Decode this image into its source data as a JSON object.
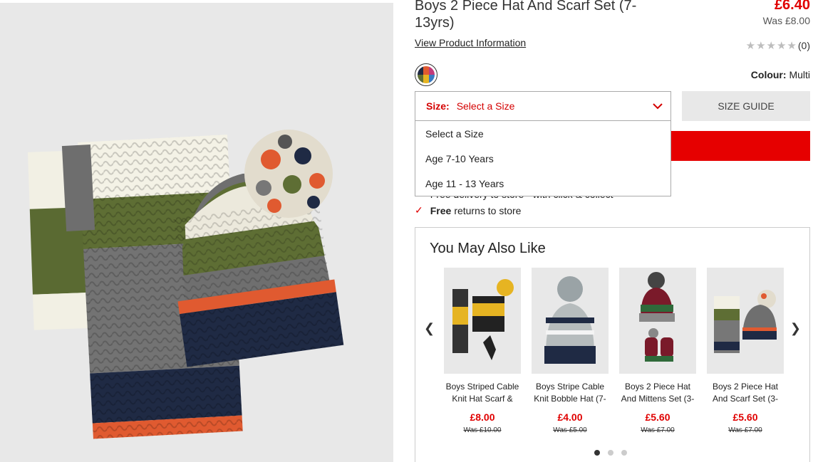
{
  "product": {
    "title": "Boys 2 Piece Hat And Scarf Set (7-13yrs)",
    "price_now": "£6.40",
    "price_was": "Was £8.00",
    "view_info_link": "View Product Information",
    "rating_count": "(0)",
    "colour_label": "Colour:",
    "colour_value": "Multi"
  },
  "size": {
    "label": "Size:",
    "selected": "Select a Size",
    "options": [
      "Select a Size",
      "Age 7-10 Years",
      "Age 11 - 13 Years"
    ],
    "guide_label": "SIZE GUIDE"
  },
  "add_to_bag": "ADD TO BAG",
  "benefits": [
    {
      "bold": "",
      "text": "Free delivery to store - with click & collect"
    },
    {
      "bold": "Free",
      "text": "returns to store"
    }
  ],
  "recommendations": {
    "title": "You May Also Like",
    "items": [
      {
        "name": "Boys Striped Cable Knit Hat Scarf &",
        "price": "£8.00",
        "was": "Was £10.00"
      },
      {
        "name": "Boys Stripe Cable Knit Bobble Hat (7-",
        "price": "£4.00",
        "was": "Was £5.00"
      },
      {
        "name": "Boys 2 Piece Hat And Mittens Set (3-",
        "price": "£5.60",
        "was": "Was £7.00"
      },
      {
        "name": "Boys 2 Piece Hat And Scarf Set (3-",
        "price": "£5.60",
        "was": "Was £7.00"
      }
    ],
    "pages": 3,
    "active_page": 1
  },
  "colors": {
    "accent": "#e60000",
    "sale_red": "#e00000"
  },
  "icons": {
    "chevron": "chevron-down-icon",
    "tick": "check-icon",
    "prev": "chevron-left-icon",
    "next": "chevron-right-icon",
    "star": "star-icon"
  }
}
